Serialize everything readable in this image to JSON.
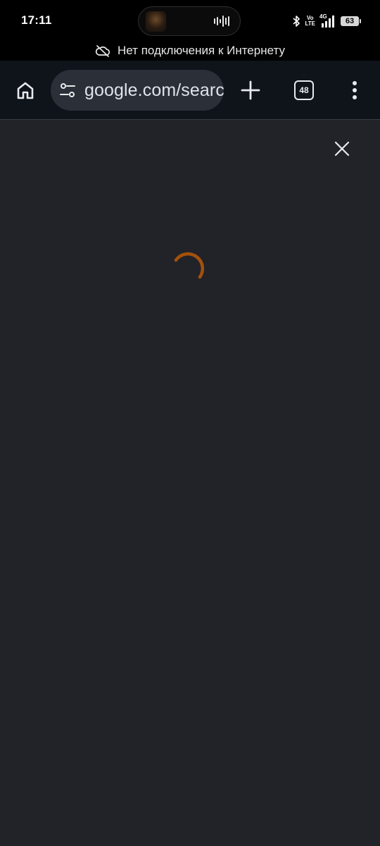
{
  "status_bar": {
    "time": "17:11",
    "volte_top": "Vo",
    "volte_bottom": "LTE",
    "network": "4G",
    "battery": "63"
  },
  "offline_banner": {
    "text": "Нет подключения к Интернету",
    "icon": "cloud-off-icon"
  },
  "toolbar": {
    "url": "google.com/search",
    "tab_count": "48",
    "icons": [
      "home-icon",
      "site-settings-icon",
      "plus-icon",
      "tab-switcher-icon",
      "more-vert-icon"
    ]
  },
  "content": {
    "icons": [
      "close-icon",
      "loading-spinner"
    ],
    "colors": {
      "background": "#222328",
      "spinner": "#a4510c",
      "toolbar": "#0f141b"
    }
  }
}
